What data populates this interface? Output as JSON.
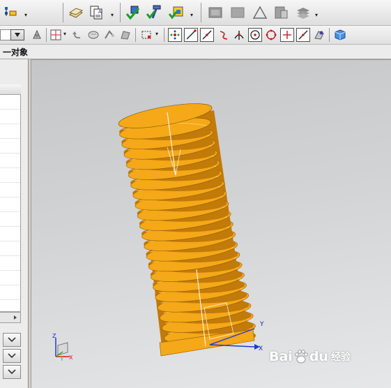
{
  "toolbar": {
    "row1_icons": [
      "assembly-tree-icon",
      "layer-folder-icon",
      "paste-document-icon",
      "check-box-icon",
      "check-hammer-icon",
      "check-component-icon",
      "view-shaded-box-icon",
      "view-wire-box-icon",
      "triangle-icon",
      "section-view-icon",
      "layers-stack-icon"
    ],
    "row2_icons": [
      "selection-filter-icon",
      "snap-point-icon",
      "undo-arrow-icon",
      "lasso-select-icon",
      "edge-select-icon",
      "face-select-icon",
      "rect-select-icon",
      "snap-endpoint-icon",
      "snap-line-icon",
      "snap-line-end-icon",
      "snap-curve-icon",
      "snap-intersection-icon",
      "snap-circle-center-icon",
      "snap-quadrant-icon",
      "snap-point-on-curve-icon",
      "snap-midpoint-icon",
      "snap-tangent-icon",
      "orient-view-icon",
      "solid-cube-icon"
    ]
  },
  "nav": {
    "label": "一对象"
  },
  "left_panel": {
    "rows": 16,
    "buttons": [
      "collapse-arrow-1",
      "collapse-arrow-2",
      "collapse-arrow-3"
    ]
  },
  "viewport": {
    "model": "threaded-screw",
    "colors": {
      "thread": "#f5a818",
      "thread_dark": "#c27a08",
      "thread_light": "#ffd060",
      "bg_top": "#c4c6c8",
      "bg_bottom": "#e6e7e8"
    }
  },
  "triad": {
    "x": "X",
    "y": "Y",
    "z": "Z"
  },
  "local_triad": {
    "x": "X",
    "y": "Y"
  },
  "watermark": {
    "brand": "Bai",
    "paw": "du",
    "sub": "经验"
  }
}
